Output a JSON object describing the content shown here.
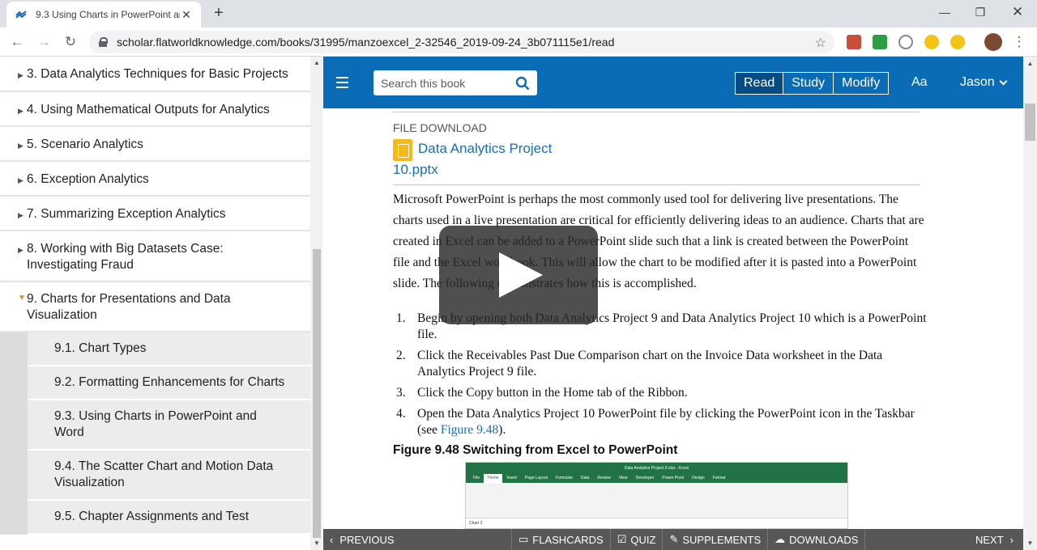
{
  "browser": {
    "tab_title": "9.3 Using Charts in PowerPoint ar",
    "url": "scholar.flatworldknowledge.com/books/31995/manzoexcel_2-32546_2019-09-24_3b071115e1/read"
  },
  "header": {
    "search_placeholder": "Search this book",
    "modes": [
      "Read",
      "Study",
      "Modify"
    ],
    "active_mode": "Read",
    "font_button": "Aa",
    "user_name": "Jason"
  },
  "sidebar": {
    "chapters": [
      "3. Data Analytics Techniques for Basic Projects",
      "4. Using Mathematical Outputs for Analytics",
      "5. Scenario Analytics",
      "6. Exception Analytics",
      "7. Summarizing Exception Analytics",
      "8. Working with Big Datasets Case: Investigating Fraud",
      "9. Charts for Presentations and Data Visualization"
    ],
    "sections": [
      "9.1. Chart Types",
      "9.2. Formatting Enhancements for Charts",
      "9.3. Using Charts in PowerPoint and Word",
      "9.4. The Scatter Chart and Motion Data Visualization",
      "9.5. Chapter Assignments and Test"
    ]
  },
  "content": {
    "file_download_label": "FILE DOWNLOAD",
    "file_name_line1": "Data Analytics Project",
    "file_name_line2": "10.pptx",
    "paragraph": "Microsoft PowerPoint is perhaps the most commonly used tool for delivering live presentations. The charts used in a live presentation are critical for efficiently delivering ideas to an audience. Charts that are created in Excel can be added to a PowerPoint slide such that a link is created between the PowerPoint file and the Excel workbook. This will allow the chart to be modified after it is pasted into a PowerPoint slide. The following demonstrates how this is accomplished.",
    "steps": [
      {
        "num": "1.",
        "text": "Begin by opening both Data Analytics Project 9 and Data Analytics Project 10 which is a PowerPoint file."
      },
      {
        "num": "2.",
        "text": "Click the Receivables Past Due Comparison chart on the Invoice Data worksheet in the Data Analytics Project 9 file."
      },
      {
        "num": "3.",
        "text": "Click the Copy button in the Home tab of the Ribbon."
      },
      {
        "num": "4.",
        "text": "Open the Data Analytics Project 10 PowerPoint file by clicking the PowerPoint icon in the Taskbar (see ",
        "link": "Figure 9.48",
        "after": ")."
      }
    ],
    "figure_caption": "Figure 9.48  Switching from Excel to PowerPoint",
    "figure": {
      "window_title": "Data Analytics Project 9.xlsx - Excel",
      "ribbon_tabs": [
        "File",
        "Home",
        "Insert",
        "Page Layout",
        "Formulas",
        "Data",
        "Review",
        "View",
        "Developer",
        "Power Pivot",
        "Design",
        "Format"
      ],
      "active_ribbon_tab": "Home",
      "name_box": "Chart 2"
    }
  },
  "footer": {
    "previous": "PREVIOUS",
    "flashcards": "FLASHCARDS",
    "quiz": "QUIZ",
    "supplements": "SUPPLEMENTS",
    "downloads": "DOWNLOADS",
    "next": "NEXT"
  }
}
